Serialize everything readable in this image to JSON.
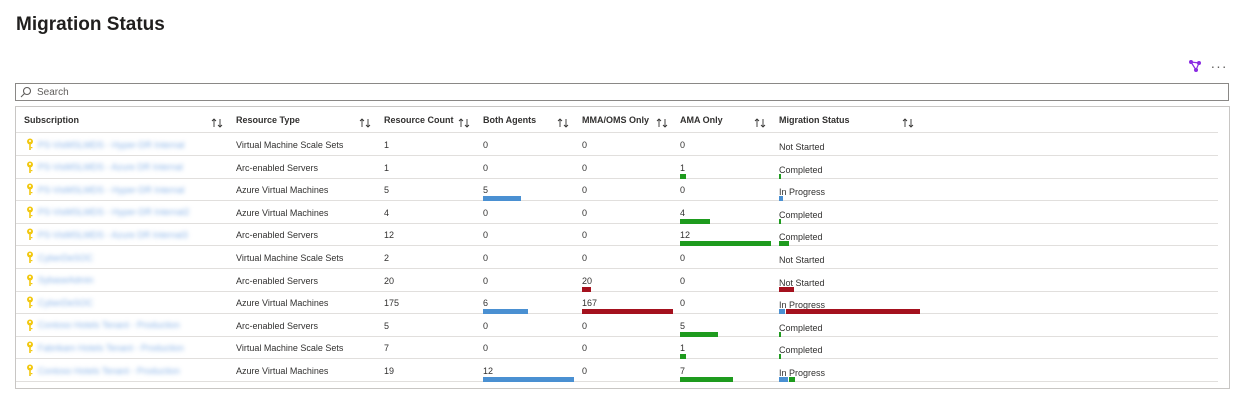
{
  "page": {
    "title": "Migration Status"
  },
  "search": {
    "placeholder": "Search"
  },
  "columns": [
    {
      "label": "Subscription"
    },
    {
      "label": "Resource Type"
    },
    {
      "label": "Resource Count"
    },
    {
      "label": "Both Agents"
    },
    {
      "label": "MMA/OMS Only"
    },
    {
      "label": "AMA Only"
    },
    {
      "label": "Migration Status"
    }
  ],
  "colors": {
    "both_agents": "#4a90d2",
    "ama_only": "#1e9b1e",
    "mma_only": "#a4111e",
    "accent": "#8a2be2"
  },
  "icons": [
    "key-icon",
    "search-icon",
    "share-icon",
    "more-icon",
    "sort-icon"
  ],
  "rows": [
    {
      "subscription": "PS-VisMSLMDS - Hyper-DR Internal",
      "resource_type": "Virtual Machine Scale Sets",
      "count": "1",
      "both": "0",
      "mma": "0",
      "ama": "0",
      "status": "Not Started",
      "both_frac": 0,
      "mma_frac": 0,
      "ama_frac": 0
    },
    {
      "subscription": "PS-VisMSLMDS - Azure DR Internal",
      "resource_type": "Arc-enabled Servers",
      "count": "1",
      "both": "0",
      "mma": "0",
      "ama": "1",
      "status": "Completed",
      "both_frac": 0,
      "mma_frac": 0,
      "ama_frac": 1
    },
    {
      "subscription": "PS-VisMSLMDS - Hyper-DR Internal",
      "resource_type": "Azure Virtual Machines",
      "count": "5",
      "both": "5",
      "mma": "0",
      "ama": "0",
      "status": "In Progress",
      "both_frac": 1,
      "mma_frac": 0,
      "ama_frac": 0
    },
    {
      "subscription": "PS-VisMSLMDS - Hyper-DR Internal2",
      "resource_type": "Azure Virtual Machines",
      "count": "4",
      "both": "0",
      "mma": "0",
      "ama": "4",
      "status": "Completed",
      "both_frac": 0,
      "mma_frac": 0,
      "ama_frac": 1
    },
    {
      "subscription": "PS-VisMSLMDS - Azure DR Internal3",
      "resource_type": "Arc-enabled Servers",
      "count": "12",
      "both": "0",
      "mma": "0",
      "ama": "12",
      "status": "Completed",
      "both_frac": 0,
      "mma_frac": 0,
      "ama_frac": 1
    },
    {
      "subscription": "CyberDeSOC",
      "resource_type": "Virtual Machine Scale Sets",
      "count": "2",
      "both": "0",
      "mma": "0",
      "ama": "0",
      "status": "Not Started",
      "both_frac": 0,
      "mma_frac": 0,
      "ama_frac": 0
    },
    {
      "subscription": "SybaseAdmin",
      "resource_type": "Arc-enabled Servers",
      "count": "20",
      "both": "0",
      "mma": "20",
      "ama": "0",
      "status": "Not Started",
      "both_frac": 0,
      "mma_frac": 1,
      "ama_frac": 0
    },
    {
      "subscription": "CyberDeSOC",
      "resource_type": "Azure Virtual Machines",
      "count": "175",
      "both": "6",
      "mma": "167",
      "ama": "0",
      "status": "In Progress",
      "both_frac": 0.034,
      "mma_frac": 0.954,
      "ama_frac": 0
    },
    {
      "subscription": "Contoso Hotels Tenant - Production",
      "resource_type": "Arc-enabled Servers",
      "count": "5",
      "both": "0",
      "mma": "0",
      "ama": "5",
      "status": "Completed",
      "both_frac": 0,
      "mma_frac": 0,
      "ama_frac": 1
    },
    {
      "subscription": "Fabrikam Hotels Tenant - Production",
      "resource_type": "Virtual Machine Scale Sets",
      "count": "7",
      "both": "0",
      "mma": "0",
      "ama": "1",
      "status": "Completed",
      "both_frac": 0,
      "mma_frac": 0,
      "ama_frac": 0.143
    },
    {
      "subscription": "Contoso Hotels Tenant - Production",
      "resource_type": "Azure Virtual Machines",
      "count": "19",
      "both": "12",
      "mma": "0",
      "ama": "7",
      "status": "In Progress",
      "both_frac": 0.632,
      "mma_frac": 0,
      "ama_frac": 0.368
    }
  ]
}
